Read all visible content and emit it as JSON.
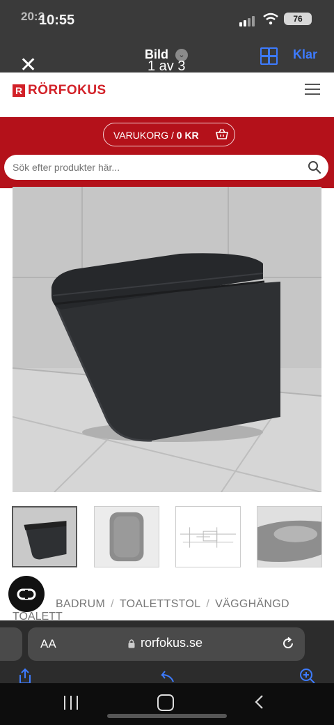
{
  "status_bar": {
    "time_ghost": "20:2",
    "time": "10:55",
    "battery": "76"
  },
  "viewer": {
    "title": "Bild",
    "counter": "1 av 3",
    "done_label": "Klar"
  },
  "site": {
    "logo_mark": "R",
    "logo_text": "RÖRFOKUS",
    "cart_label": "VARUKORG / ",
    "cart_amount": "0 KR",
    "search_placeholder": "Sök efter produkter här...",
    "breadcrumb": [
      "BADRUM",
      "TOALETTSTOL",
      "VÄGGHÄNGD"
    ],
    "breadcrumb_overflow": "TOALETT",
    "thumbnails": [
      "black-toilet-side",
      "grey-toilet-top",
      "technical-drawing",
      "grey-toilet-inside"
    ]
  },
  "safari": {
    "text_size_label": "AA",
    "url": "rorfokus.se"
  },
  "colors": {
    "brand_red": "#b4111a",
    "logo_red": "#d22128",
    "ios_blue": "#3d7bff"
  }
}
